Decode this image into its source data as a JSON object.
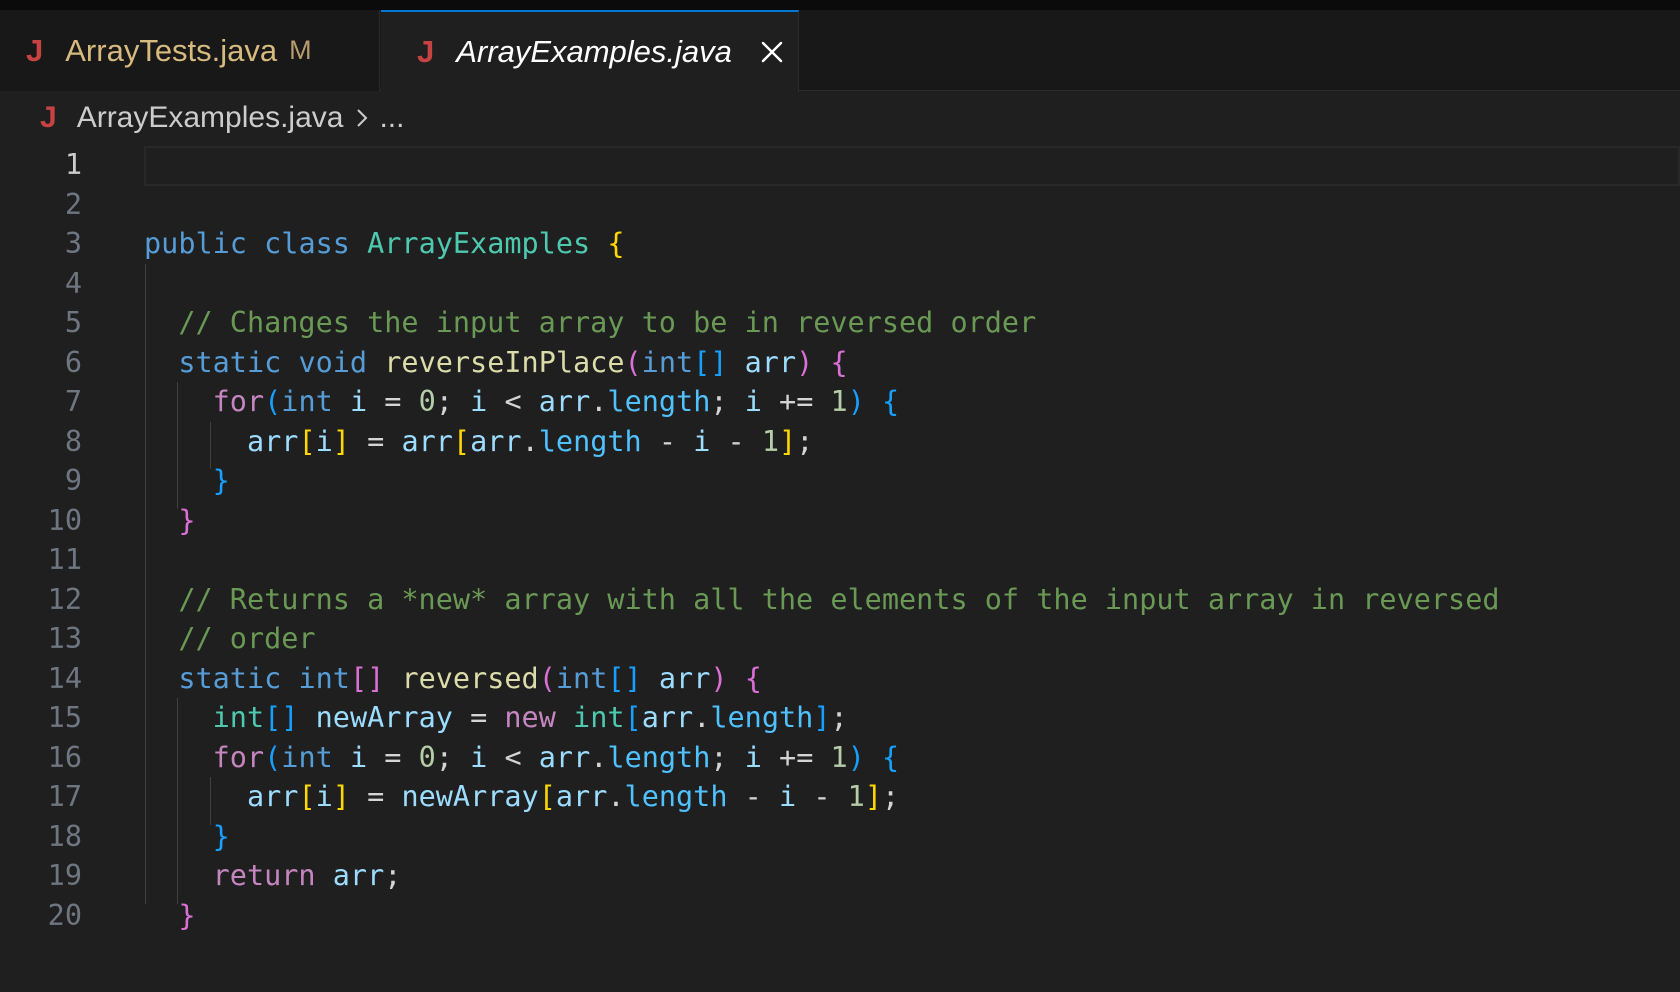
{
  "colors": {
    "java_icon": "#c74343",
    "tab_active_border": "#0078d4",
    "modified_badge": "#d7ba7d"
  },
  "tabs": [
    {
      "icon": "java-icon",
      "icon_glyph": "J",
      "label": "ArrayTests.java",
      "badge": "M"
    },
    {
      "icon": "java-icon",
      "icon_glyph": "J",
      "label": "ArrayExamples.java",
      "close": "close-icon"
    }
  ],
  "breadcrumb": {
    "icon_glyph": "J",
    "file": "ArrayExamples.java",
    "ellipsis": "..."
  },
  "editor": {
    "active_line": 1,
    "lines": [
      {
        "n": "1",
        "tokens": []
      },
      {
        "n": "2",
        "tokens": []
      },
      {
        "n": "3",
        "tokens": [
          [
            "kw",
            "public"
          ],
          [
            "op",
            " "
          ],
          [
            "kw",
            "class"
          ],
          [
            "op",
            " "
          ],
          [
            "cls",
            "ArrayExamples"
          ],
          [
            "op",
            " "
          ],
          [
            "b1",
            "{"
          ]
        ]
      },
      {
        "n": "4",
        "tokens": []
      },
      {
        "n": "5",
        "tokens": [
          [
            "op",
            "  "
          ],
          [
            "cmt",
            "// Changes the input array to be in reversed order"
          ]
        ]
      },
      {
        "n": "6",
        "tokens": [
          [
            "op",
            "  "
          ],
          [
            "kw",
            "static"
          ],
          [
            "op",
            " "
          ],
          [
            "kw",
            "void"
          ],
          [
            "op",
            " "
          ],
          [
            "fn",
            "reverseInPlace"
          ],
          [
            "b2",
            "("
          ],
          [
            "kw",
            "int"
          ],
          [
            "b3",
            "[]"
          ],
          [
            "op",
            " "
          ],
          [
            "var",
            "arr"
          ],
          [
            "b2",
            ")"
          ],
          [
            "op",
            " "
          ],
          [
            "b2",
            "{"
          ]
        ]
      },
      {
        "n": "7",
        "tokens": [
          [
            "op",
            "    "
          ],
          [
            "ctl",
            "for"
          ],
          [
            "b3",
            "("
          ],
          [
            "kw",
            "int"
          ],
          [
            "op",
            " "
          ],
          [
            "var",
            "i"
          ],
          [
            "op",
            " = "
          ],
          [
            "num",
            "0"
          ],
          [
            "op",
            "; "
          ],
          [
            "var",
            "i"
          ],
          [
            "op",
            " < "
          ],
          [
            "var",
            "arr"
          ],
          [
            "op",
            "."
          ],
          [
            "prop",
            "length"
          ],
          [
            "op",
            "; "
          ],
          [
            "var",
            "i"
          ],
          [
            "op",
            " += "
          ],
          [
            "num",
            "1"
          ],
          [
            "b3",
            ")"
          ],
          [
            "op",
            " "
          ],
          [
            "b3",
            "{"
          ]
        ]
      },
      {
        "n": "8",
        "tokens": [
          [
            "op",
            "      "
          ],
          [
            "var",
            "arr"
          ],
          [
            "b1",
            "["
          ],
          [
            "var",
            "i"
          ],
          [
            "b1",
            "]"
          ],
          [
            "op",
            " = "
          ],
          [
            "var",
            "arr"
          ],
          [
            "b1",
            "["
          ],
          [
            "var",
            "arr"
          ],
          [
            "op",
            "."
          ],
          [
            "prop",
            "length"
          ],
          [
            "op",
            " - "
          ],
          [
            "var",
            "i"
          ],
          [
            "op",
            " - "
          ],
          [
            "num",
            "1"
          ],
          [
            "b1",
            "]"
          ],
          [
            "op",
            ";"
          ]
        ]
      },
      {
        "n": "9",
        "tokens": [
          [
            "op",
            "    "
          ],
          [
            "b3",
            "}"
          ]
        ]
      },
      {
        "n": "10",
        "tokens": [
          [
            "op",
            "  "
          ],
          [
            "b2",
            "}"
          ]
        ]
      },
      {
        "n": "11",
        "tokens": []
      },
      {
        "n": "12",
        "tokens": [
          [
            "op",
            "  "
          ],
          [
            "cmt",
            "// Returns a *new* array with all the elements of the input array in reversed"
          ]
        ]
      },
      {
        "n": "13",
        "tokens": [
          [
            "op",
            "  "
          ],
          [
            "cmt",
            "// order"
          ]
        ]
      },
      {
        "n": "14",
        "tokens": [
          [
            "op",
            "  "
          ],
          [
            "kw",
            "static"
          ],
          [
            "op",
            " "
          ],
          [
            "kw",
            "int"
          ],
          [
            "b2",
            "[]"
          ],
          [
            "op",
            " "
          ],
          [
            "fn",
            "reversed"
          ],
          [
            "b2",
            "("
          ],
          [
            "kw",
            "int"
          ],
          [
            "b3",
            "[]"
          ],
          [
            "op",
            " "
          ],
          [
            "var",
            "arr"
          ],
          [
            "b2",
            ")"
          ],
          [
            "op",
            " "
          ],
          [
            "b2",
            "{"
          ]
        ]
      },
      {
        "n": "15",
        "tokens": [
          [
            "op",
            "    "
          ],
          [
            "cls",
            "int"
          ],
          [
            "b3",
            "[]"
          ],
          [
            "op",
            " "
          ],
          [
            "var",
            "newArray"
          ],
          [
            "op",
            " = "
          ],
          [
            "ctl",
            "new"
          ],
          [
            "op",
            " "
          ],
          [
            "cls",
            "int"
          ],
          [
            "b3",
            "["
          ],
          [
            "var",
            "arr"
          ],
          [
            "op",
            "."
          ],
          [
            "prop",
            "length"
          ],
          [
            "b3",
            "]"
          ],
          [
            "op",
            ";"
          ]
        ]
      },
      {
        "n": "16",
        "tokens": [
          [
            "op",
            "    "
          ],
          [
            "ctl",
            "for"
          ],
          [
            "b3",
            "("
          ],
          [
            "kw",
            "int"
          ],
          [
            "op",
            " "
          ],
          [
            "var",
            "i"
          ],
          [
            "op",
            " = "
          ],
          [
            "num",
            "0"
          ],
          [
            "op",
            "; "
          ],
          [
            "var",
            "i"
          ],
          [
            "op",
            " < "
          ],
          [
            "var",
            "arr"
          ],
          [
            "op",
            "."
          ],
          [
            "prop",
            "length"
          ],
          [
            "op",
            "; "
          ],
          [
            "var",
            "i"
          ],
          [
            "op",
            " += "
          ],
          [
            "num",
            "1"
          ],
          [
            "b3",
            ")"
          ],
          [
            "op",
            " "
          ],
          [
            "b3",
            "{"
          ]
        ]
      },
      {
        "n": "17",
        "tokens": [
          [
            "op",
            "      "
          ],
          [
            "var",
            "arr"
          ],
          [
            "b1",
            "["
          ],
          [
            "var",
            "i"
          ],
          [
            "b1",
            "]"
          ],
          [
            "op",
            " = "
          ],
          [
            "var",
            "newArray"
          ],
          [
            "b1",
            "["
          ],
          [
            "var",
            "arr"
          ],
          [
            "op",
            "."
          ],
          [
            "prop",
            "length"
          ],
          [
            "op",
            " - "
          ],
          [
            "var",
            "i"
          ],
          [
            "op",
            " - "
          ],
          [
            "num",
            "1"
          ],
          [
            "b1",
            "]"
          ],
          [
            "op",
            ";"
          ]
        ]
      },
      {
        "n": "18",
        "tokens": [
          [
            "op",
            "    "
          ],
          [
            "b3",
            "}"
          ]
        ]
      },
      {
        "n": "19",
        "tokens": [
          [
            "op",
            "    "
          ],
          [
            "ctl",
            "return"
          ],
          [
            "op",
            " "
          ],
          [
            "var",
            "arr"
          ],
          [
            "op",
            ";"
          ]
        ]
      },
      {
        "n": "20",
        "tokens": [
          [
            "op",
            "  "
          ],
          [
            "b2",
            "}"
          ]
        ]
      }
    ]
  }
}
